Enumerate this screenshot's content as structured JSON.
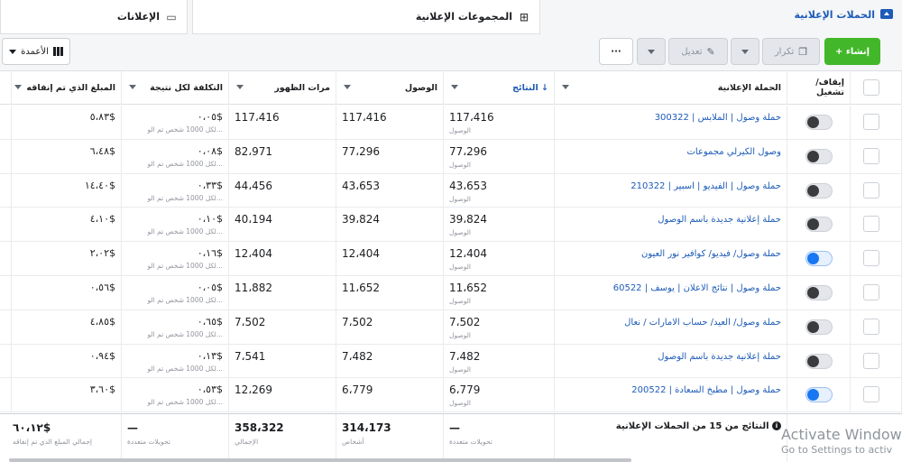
{
  "tabs": {
    "campaigns": "الحملات الإعلانية",
    "adsets": "المجموعات الإعلانية",
    "ads": "الإعلانات"
  },
  "toolbar": {
    "create": "+ إنشاء",
    "duplicate": "تكرار",
    "edit": "تعديل",
    "more": "···",
    "columns": "الأعمدة"
  },
  "headers": {
    "toggle": "إيقاف/ تشغيل",
    "campaign": "الحملة الإعلانية",
    "results": "النتائج ↓",
    "reach": "الوصول",
    "impressions": "مرات الظهور",
    "cost_per_result": "التكلفة لكل نتيجة",
    "amount_spent": "المبلغ الذي تم إنفاقه"
  },
  "result_label": "الوصول",
  "cost_label": "لكل 1000 شخص تم الو...",
  "rows": [
    {
      "on": false,
      "name": "حملة وصول | الملابس | 300322",
      "results": "117،416",
      "reach": "117،416",
      "impressions": "117،416",
      "cost": "٠،٠٥$",
      "spent": "٥،٨٣$"
    },
    {
      "on": false,
      "name": "وصول الكيرلي مجموعات",
      "results": "77،296",
      "reach": "77،296",
      "impressions": "82،971",
      "cost": "٠،٠٨$",
      "spent": "٦،٤٨$"
    },
    {
      "on": false,
      "name": "حملة وصول | الفيديو | اسبير | 210322",
      "results": "43،653",
      "reach": "43،653",
      "impressions": "44،456",
      "cost": "٠،٣٣$",
      "spent": "١٤،٤٠$"
    },
    {
      "on": false,
      "name": "حملة إعلانية جديدة باسم الوصول",
      "results": "39،824",
      "reach": "39،824",
      "impressions": "40،194",
      "cost": "٠،١٠$",
      "spent": "٤،١٠$"
    },
    {
      "on": true,
      "name": "حملة وصول/ فيديو/ كوافير نور العيون",
      "results": "12،404",
      "reach": "12،404",
      "impressions": "12،404",
      "cost": "٠،١٦$",
      "spent": "٢،٠٢$"
    },
    {
      "on": false,
      "name": "حملة وصول | نتائج الاعلان | يوسف | 60522",
      "results": "11،652",
      "reach": "11،652",
      "impressions": "11،882",
      "cost": "٠،٠٥$",
      "spent": "٠،٥٦$"
    },
    {
      "on": false,
      "name": "حملة وصول/ العيد/ حساب الامارات / نعال",
      "results": "7،502",
      "reach": "7،502",
      "impressions": "7،502",
      "cost": "٠،٦٥$",
      "spent": "٤،٨٥$"
    },
    {
      "on": false,
      "name": "حملة إعلانية جديدة باسم الوصول",
      "results": "7،482",
      "reach": "7،482",
      "impressions": "7،541",
      "cost": "٠،١٣$",
      "spent": "٠،٩٤$"
    },
    {
      "on": true,
      "name": "حملة وصول | مطبخ السعادة | 200522",
      "results": "6،779",
      "reach": "6،779",
      "impressions": "12،269",
      "cost": "٠،٥٣$",
      "spent": "٣،٦٠$"
    }
  ],
  "footer": {
    "title": "النتائج من 15 من الحملات الإعلانية",
    "results": "—",
    "results_sub": "تحويلات متعددة",
    "reach": "314،173",
    "reach_sub": "أشخاص",
    "impressions": "358،322",
    "impressions_sub": "الإجمالي",
    "cost": "—",
    "cost_sub": "تحويلات متعددة",
    "spent": "٦٠،١٢$",
    "spent_sub": "إجمالي المبلغ الذي تم إنفاقه"
  },
  "watermark": {
    "line1": "Activate Windows",
    "line2": "Go to Settings to activ"
  }
}
